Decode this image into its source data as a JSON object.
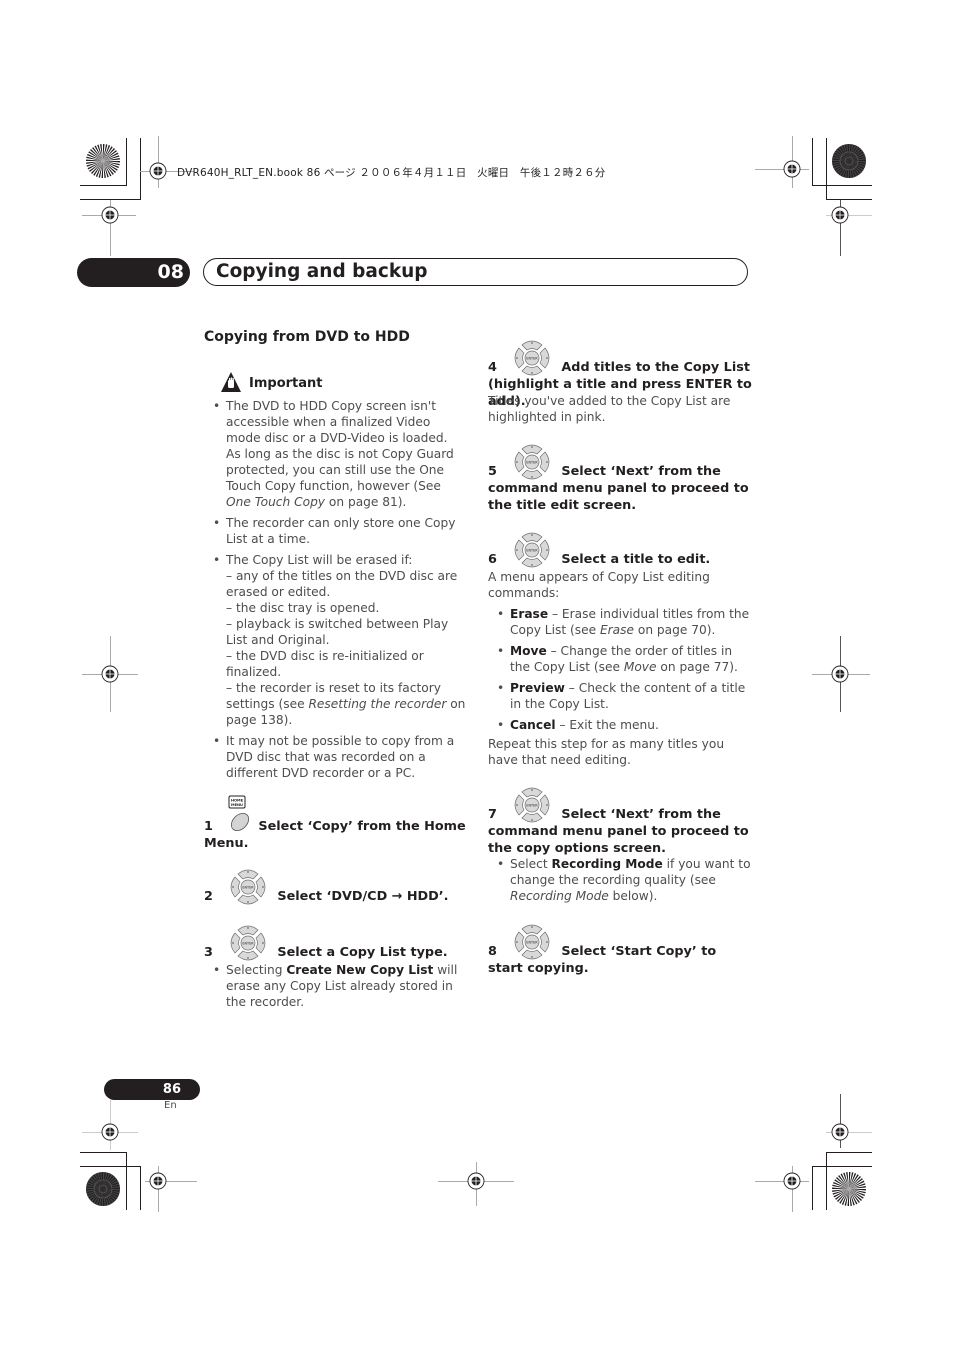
{
  "header": {
    "file_info": "DVR640H_RLT_EN.book  86 ページ  ２００６年４月１１日　火曜日　午後１２時２６分"
  },
  "chapter": {
    "number": "08",
    "title": "Copying and backup"
  },
  "section": {
    "title": "Copying from DVD to HDD"
  },
  "important": {
    "icon": "warning-hand-icon",
    "label": "Important",
    "bullets": [
      {
        "parts": [
          {
            "t": "The DVD to HDD Copy screen isn't accessible when a finalized Video mode disc or a DVD-Video is loaded. As long as the disc is not Copy Guard protected, you can still use the One Touch Copy function, however (See "
          },
          {
            "t": "One Touch Copy",
            "style": "italic"
          },
          {
            "t": " on page 81)."
          }
        ]
      },
      {
        "parts": [
          {
            "t": "The recorder can only store one Copy List at a time."
          }
        ]
      },
      {
        "intro": "The Copy List will be erased if:",
        "subitems": [
          "– any of the titles on the DVD disc are erased or edited.",
          "– the disc tray is opened.",
          "– playback is switched between Play List and Original.",
          "– the DVD disc is re-initialized or finalized."
        ],
        "last_sub_parts": [
          {
            "t": "– the recorder is reset to its factory settings (see "
          },
          {
            "t": "Resetting the recorder",
            "style": "italic"
          },
          {
            "t": " on page 138)."
          }
        ]
      },
      {
        "parts": [
          {
            "t": "It may not be possible to copy from a DVD disc that was recorded on a different DVD recorder or a PC."
          }
        ]
      }
    ]
  },
  "steps": [
    {
      "number": "1",
      "icon": "home-menu-button-icon",
      "icon_label": "HOME MENU",
      "text": "Select ‘Copy’ from the Home Menu."
    },
    {
      "number": "2",
      "icon": "enter-dpad-icon",
      "text": "Select ‘DVD/CD → HDD’."
    },
    {
      "number": "3",
      "icon": "enter-dpad-icon",
      "text": "Select a Copy List type.",
      "bullets": [
        [
          {
            "t": "Selecting "
          },
          {
            "t": "Create New Copy List",
            "style": "bold"
          },
          {
            "t": " will erase any Copy List already stored in the recorder."
          }
        ]
      ]
    },
    {
      "number": "4",
      "icon": "enter-dpad-icon",
      "text": "Add titles to the Copy List (highlight a title and press ENTER to add).",
      "para": "Titles you've added to the Copy List are highlighted in pink."
    },
    {
      "number": "5",
      "icon": "enter-dpad-icon",
      "text": "Select ‘Next’ from the command menu panel to proceed to the title edit screen."
    },
    {
      "number": "6",
      "icon": "enter-dpad-icon",
      "text": "Select a title to edit.",
      "para": "A menu appears of Copy List editing commands:",
      "bullets": [
        [
          {
            "t": "Erase",
            "style": "bold"
          },
          {
            "t": " – Erase individual titles from the Copy List (see "
          },
          {
            "t": "Erase",
            "style": "italic"
          },
          {
            "t": " on page 70)."
          }
        ],
        [
          {
            "t": "Move",
            "style": "bold"
          },
          {
            "t": " – Change the order of titles in the Copy List (see "
          },
          {
            "t": "Move",
            "style": "italic"
          },
          {
            "t": " on page 77)."
          }
        ],
        [
          {
            "t": "Preview",
            "style": "bold"
          },
          {
            "t": " – Check the content of a title in the Copy List."
          }
        ],
        [
          {
            "t": "Cancel",
            "style": "bold"
          },
          {
            "t": " – Exit the menu."
          }
        ]
      ],
      "para_after": "Repeat this step for as many titles you have that need editing."
    },
    {
      "number": "7",
      "icon": "enter-dpad-icon",
      "text": "Select ‘Next’ from the command menu panel to proceed to the copy options screen.",
      "bullets": [
        [
          {
            "t": "Select "
          },
          {
            "t": "Recording Mode",
            "style": "bold"
          },
          {
            "t": " if you want to change the recording quality (see "
          },
          {
            "t": "Recording Mode",
            "style": "italic"
          },
          {
            "t": " below)."
          }
        ]
      ]
    },
    {
      "number": "8",
      "icon": "enter-dpad-icon",
      "text": "Select ‘Start Copy’ to start copying."
    }
  ],
  "dpad_center_label": "ENTER",
  "footer": {
    "page_number": "86",
    "language": "En"
  }
}
